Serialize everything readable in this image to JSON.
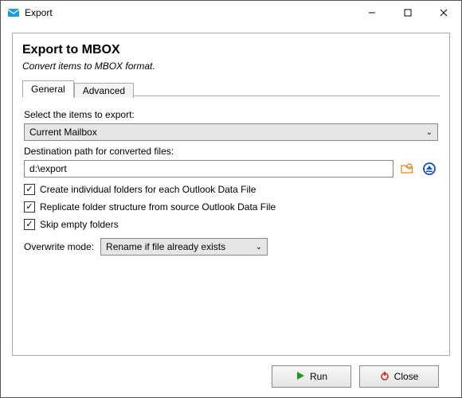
{
  "window": {
    "title": "Export"
  },
  "panel": {
    "heading": "Export to MBOX",
    "subtitle": "Convert items to MBOX format."
  },
  "tabs": {
    "general": "General",
    "advanced": "Advanced"
  },
  "general": {
    "select_items_label": "Select the items to export:",
    "items_dropdown_value": "Current Mailbox",
    "dest_label": "Destination path for converted files:",
    "dest_value": "d:\\export",
    "chk_individual": "Create individual folders for each Outlook Data File",
    "chk_replicate": "Replicate folder structure from source Outlook Data File",
    "chk_skip": "Skip empty folders",
    "overwrite_label": "Overwrite mode:",
    "overwrite_value": "Rename if file already exists",
    "checked": {
      "individual": true,
      "replicate": true,
      "skip": true
    }
  },
  "buttons": {
    "run": "Run",
    "close": "Close"
  },
  "icons": {
    "check": "✓",
    "chevron": "⌄"
  }
}
